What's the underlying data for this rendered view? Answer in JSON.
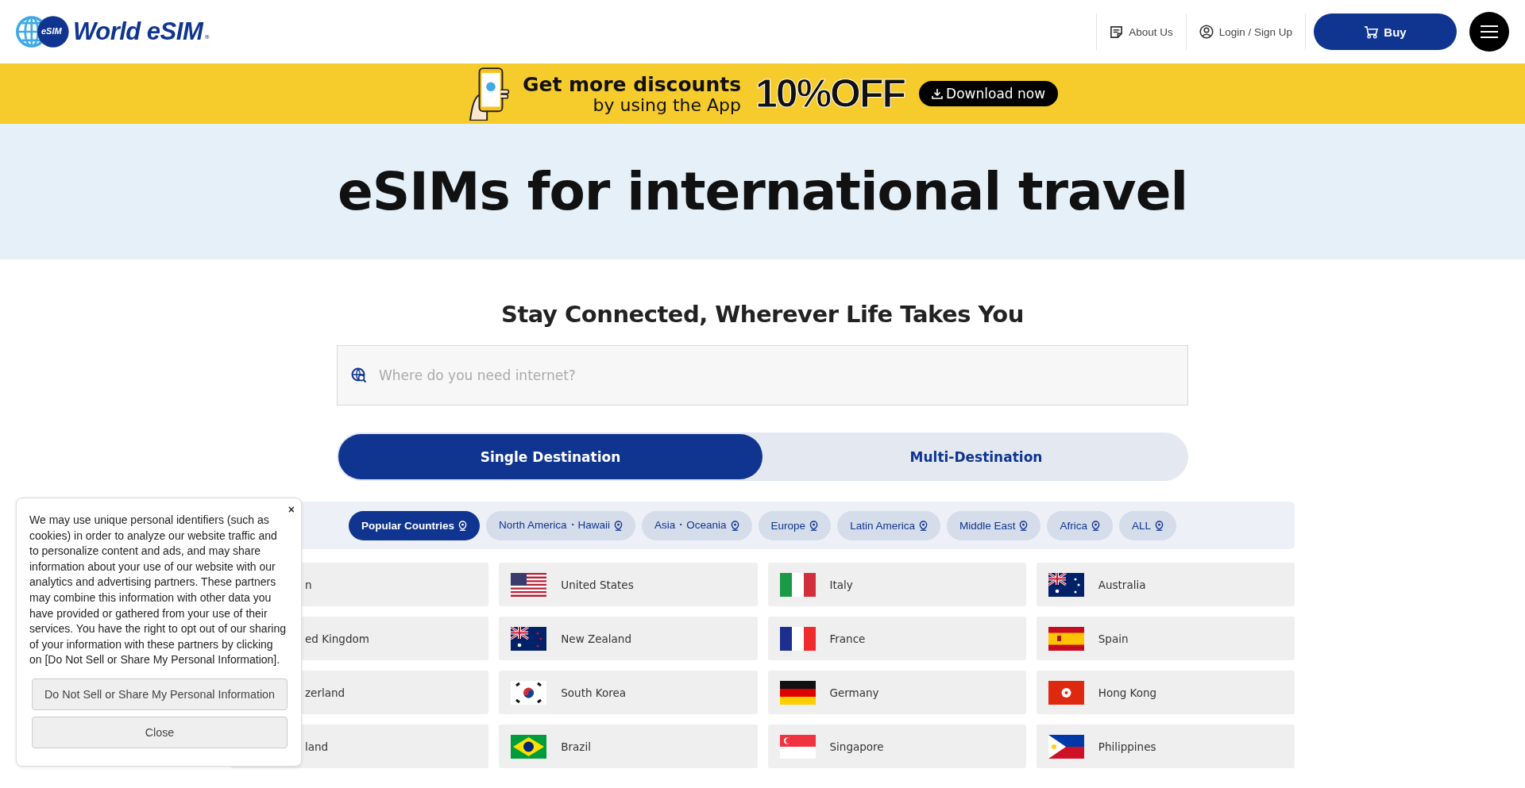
{
  "header": {
    "logo": {
      "badge": "eSIM",
      "name": "World eSIM",
      "mark": "®"
    },
    "nav": [
      {
        "label": "About Us"
      },
      {
        "label": "Login / Sign Up"
      }
    ],
    "buy_button": "Buy"
  },
  "banner": {
    "headline": "Get more discounts",
    "subline": "by using the App",
    "offer": "10%OFF",
    "button": "Download now"
  },
  "hero": {
    "title": "eSIMs for international travel"
  },
  "subtitle": "Stay Connected, Wherever Life Takes You",
  "search": {
    "placeholder": "Where do you need internet?"
  },
  "modes": [
    {
      "label": "Single Destination",
      "selected": true
    },
    {
      "label": "Multi-Destination",
      "selected": false
    }
  ],
  "regions": [
    {
      "label": "Popular Countries",
      "selected": true
    },
    {
      "label": "North America・Hawaii",
      "selected": false
    },
    {
      "label": "Asia・Oceania",
      "selected": false
    },
    {
      "label": "Europe",
      "selected": false
    },
    {
      "label": "Latin America",
      "selected": false
    },
    {
      "label": "Middle East",
      "selected": false
    },
    {
      "label": "Africa",
      "selected": false
    },
    {
      "label": "ALL",
      "selected": false
    }
  ],
  "countries": [
    {
      "name": "n",
      "kind": "covered"
    },
    {
      "name": "United States",
      "kind": "flagged"
    },
    {
      "name": "Italy",
      "kind": "flagged"
    },
    {
      "name": "Australia",
      "kind": "flagged"
    },
    {
      "name": "ed Kingdom",
      "kind": "covered"
    },
    {
      "name": "New Zealand",
      "kind": "flagged"
    },
    {
      "name": "France",
      "kind": "flagged"
    },
    {
      "name": "Spain",
      "kind": "flagged"
    },
    {
      "name": "zerland",
      "kind": "covered"
    },
    {
      "name": "South Korea",
      "kind": "flagged"
    },
    {
      "name": "Germany",
      "kind": "flagged"
    },
    {
      "name": "Hong Kong",
      "kind": "flagged"
    },
    {
      "name": "land",
      "kind": "covered"
    },
    {
      "name": "Brazil",
      "kind": "flagged"
    },
    {
      "name": "Singapore",
      "kind": "flagged"
    },
    {
      "name": "Philippines",
      "kind": "flagged"
    }
  ],
  "cookie_notice": {
    "close": "×",
    "text": "We may use unique personal identifiers (such as cookies) in order to analyze our website traffic and to personalize content and ads, and may share information about your use of our website with our analytics and advertising partners. These partners may combine this information with other data you have provided or gathered from your use of their services. You have the right to opt out of our sharing of your information with these partners by clicking on [Do Not Sell or Share My Personal Information].",
    "buttons": [
      "Do Not Sell or Share My Personal Information",
      "Close"
    ]
  }
}
